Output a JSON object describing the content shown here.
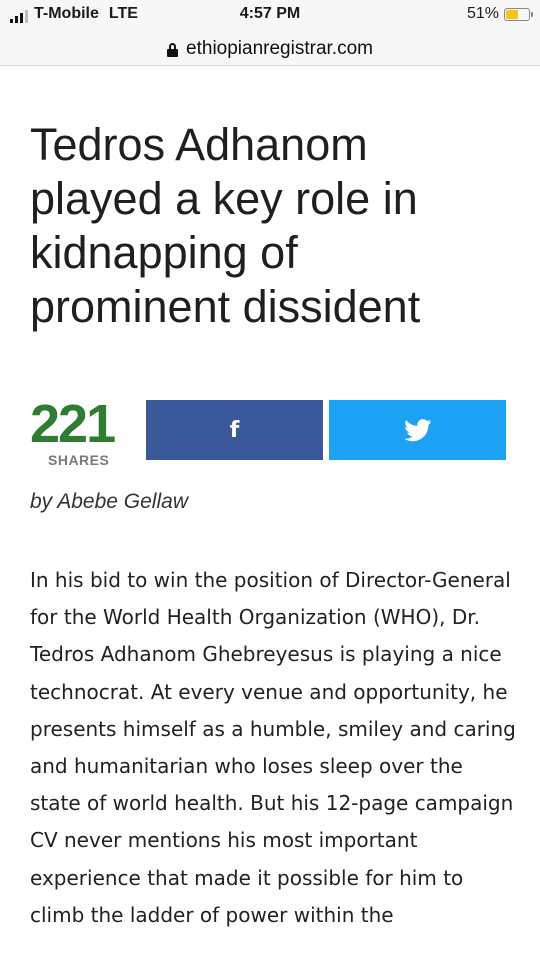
{
  "status_bar": {
    "carrier": "T-Mobile",
    "network": "LTE",
    "time": "4:57 PM",
    "battery_percent": "51%",
    "battery_level": 0.51,
    "battery_color": "#f5c518"
  },
  "browser": {
    "url": "ethiopianregistrar.com",
    "lock_icon": "lock-icon"
  },
  "article": {
    "headline": "Tedros Adhanom played a key role in kidnapping of prominent dissident",
    "shares_count": "221",
    "shares_label": "SHARES",
    "share_buttons": {
      "facebook_icon": "facebook-icon",
      "facebook_color": "#3b5998",
      "twitter_icon": "twitter-icon",
      "twitter_color": "#1da1f2"
    },
    "byline": "by Abebe Gellaw",
    "body": "In his bid to win the position of Director-General for the World Health Organization (WHO), Dr. Tedros Adhanom Ghebreyesus is playing a nice technocrat. At every venue and opportunity, he presents himself as a humble, smiley and caring and humanitarian who loses sleep over the state of world health. But his 12-page campaign CV never mentions his most important experience that made it possible for him to climb the ladder of power within the"
  }
}
